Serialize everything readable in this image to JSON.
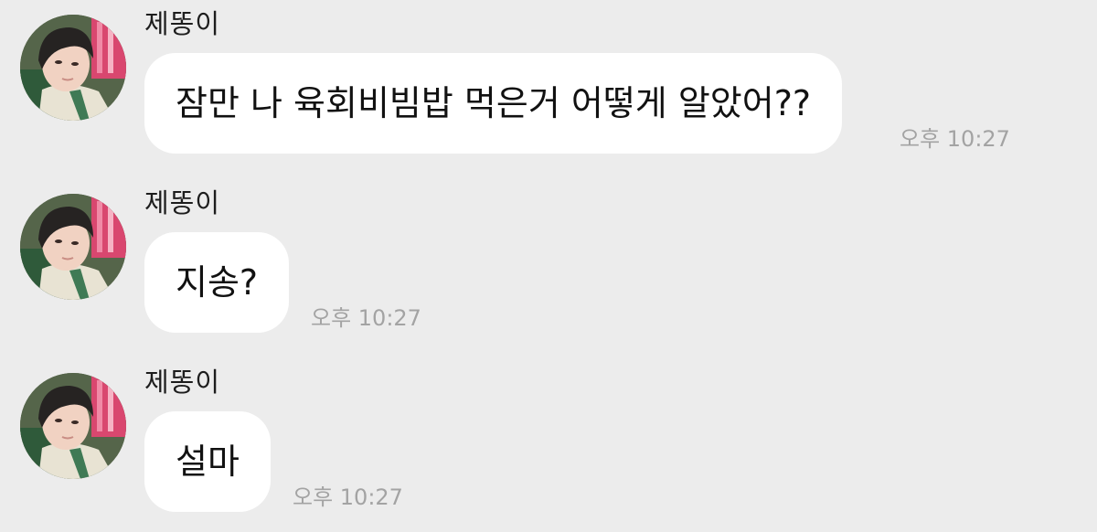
{
  "chat": {
    "messages": [
      {
        "sender": "제똥이",
        "text": "잠만 나 육회비빔밥 먹은거 어떻게 알았어??",
        "time": "오후 10:27"
      },
      {
        "sender": "제똥이",
        "text": "지송?",
        "time": "오후 10:27"
      },
      {
        "sender": "제똥이",
        "text": "설마",
        "time": "오후 10:27"
      }
    ]
  },
  "colors": {
    "background": "#ececec",
    "bubble": "#ffffff",
    "timestamp": "#a3a3a3"
  },
  "icons": {
    "avatar": "profile-photo"
  }
}
